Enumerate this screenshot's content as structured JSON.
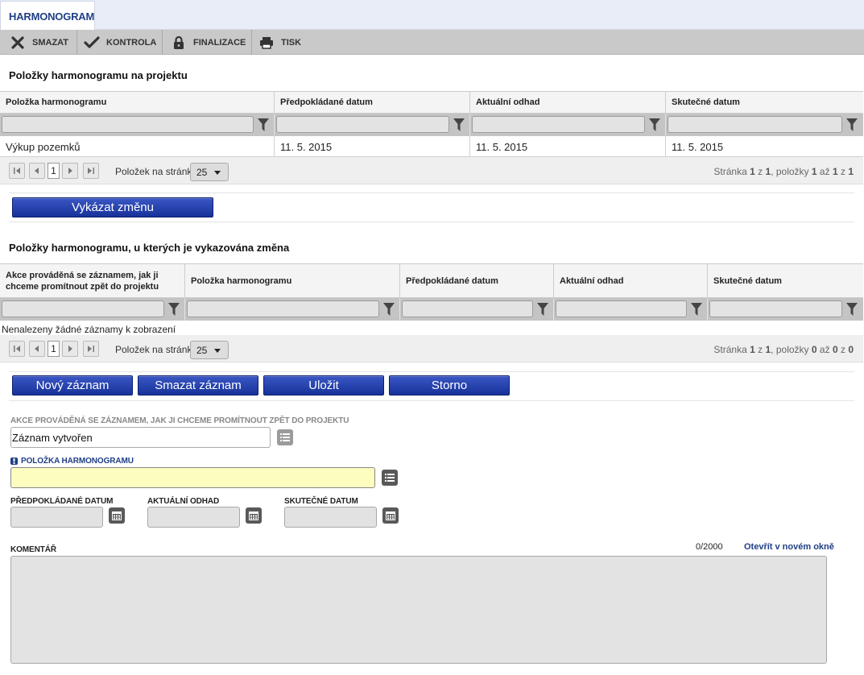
{
  "tabs": [
    {
      "label": "HARMONOGRAM"
    }
  ],
  "toolbar": [
    {
      "label": "SMAZAT",
      "icon": "delete-icon"
    },
    {
      "label": "KONTROLA",
      "icon": "check-icon"
    },
    {
      "label": "FINALIZACE",
      "icon": "lock-icon"
    },
    {
      "label": "TISK",
      "icon": "print-icon"
    }
  ],
  "section1": {
    "title": "Položky harmonogramu na projektu",
    "columns": [
      "Položka harmonogramu",
      "Předpokládané datum",
      "Aktuální odhad",
      "Skutečné datum"
    ],
    "rows": [
      [
        "Výkup pozemků",
        "11. 5. 2015",
        "11. 5. 2015",
        "11. 5. 2015"
      ]
    ],
    "pager": {
      "page": "1",
      "per_page_label": "Položek na stránku",
      "per_page": "25",
      "info": {
        "w_page": "Stránka",
        "page": "1",
        "w_of1": "z",
        "pages": "1",
        "w_items": ", položky",
        "from": "1",
        "w_to": "až",
        "to": "1",
        "w_of2": "z",
        "total": "1"
      }
    }
  },
  "report_change_button": "Vykázat změnu",
  "section2": {
    "title": "Položky harmonogramu, u kterých je vykazována změna",
    "columns": [
      "Akce prováděná se záznamem, jak ji chceme promítnout zpět do projektu",
      "Položka harmonogramu",
      "Předpokládané datum",
      "Aktuální odhad",
      "Skutečné datum"
    ],
    "empty_text": "Nenalezeny žádné záznamy k zobrazení",
    "pager": {
      "page": "1",
      "per_page_label": "Položek na stránku",
      "per_page": "25",
      "info": {
        "w_page": "Stránka",
        "page": "1",
        "w_of1": "z",
        "pages": "1",
        "w_items": ", položky",
        "from": "0",
        "w_to": "až",
        "to": "0",
        "w_of2": "z",
        "total": "0"
      }
    }
  },
  "actions": {
    "new": "Nový záznam",
    "delete": "Smazat záznam",
    "save": "Uložit",
    "cancel": "Storno"
  },
  "form": {
    "action_label": "AKCE PROVÁDĚNÁ SE ZÁZNAMEM, JAK JI CHCEME PROMÍTNOUT ZPĚT DO PROJEKTU",
    "action_value": "Záznam vytvořen",
    "item_label": "POLOŽKA HARMONOGRAMU",
    "item_value": "",
    "expected_date_label": "PŘEDPOKLÁDANÉ DATUM",
    "estimate_label": "AKTUÁLNÍ ODHAD",
    "actual_date_label": "SKUTEČNÉ DATUM",
    "comment_label": "KOMENTÁŘ",
    "comment_counter": "0/2000",
    "open_new_window": "Otevřít v novém okně"
  },
  "colors": {
    "accent": "#1f3f86",
    "button": "#2443b0",
    "required": "#fdfdc0",
    "toolbar": "#c9c9c9"
  }
}
